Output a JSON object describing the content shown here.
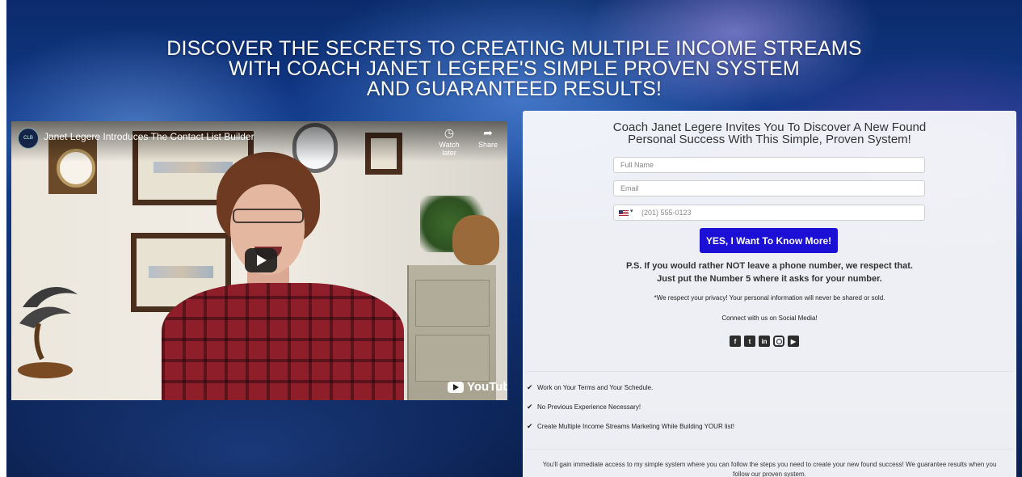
{
  "headline": {
    "line1": "DISCOVER THE SECRETS TO CREATING MULTIPLE INCOME STREAMS",
    "line2": "WITH COACH JANET LEGERE'S SIMPLE PROVEN SYSTEM",
    "line3": "AND GUARANTEED RESULTS!"
  },
  "video": {
    "title": "Janet Legere Introduces The Contact List Builder",
    "channel_badge": "CLB",
    "watch_later": "Watch later",
    "share": "Share",
    "youtube_label": "YouTube",
    "icons": [
      "clock-icon",
      "share-icon",
      "play-icon",
      "youtube-icon"
    ]
  },
  "form": {
    "heading_line1": "Coach Janet Legere Invites You To Discover A New Found",
    "heading_line2": "Personal Success With This Simple, Proven System!",
    "full_name_placeholder": "Full Name",
    "email_placeholder": "Email",
    "phone_placeholder": "(201) 555-0123",
    "country_flag": "us-flag-icon",
    "submit_label": "YES, I Want To Know More!",
    "submit_color": "#1c10d6",
    "ps_line1": "P.S. If you would rather NOT leave a phone number, we respect that.",
    "ps_line2": "Just put the Number 5 where it asks for your number.",
    "privacy": "*We respect your privacy! Your personal information will never be shared or sold.",
    "connect": "Connect with us on Social Media!",
    "social_icons": [
      "facebook-icon",
      "twitter-icon",
      "linkedin-icon",
      "instagram-icon",
      "youtube-icon"
    ]
  },
  "benefits": [
    "Work on Your Terms and Your Schedule.",
    "No Previous Experience Necessary!",
    "Create Multiple Income Streams Marketing While Building YOUR list!"
  ],
  "footer": {
    "line1": "You'll gain immediate access to my simple system where you can follow the steps you need to create your new found success! We guarantee results when you",
    "line2": "follow our proven system."
  }
}
